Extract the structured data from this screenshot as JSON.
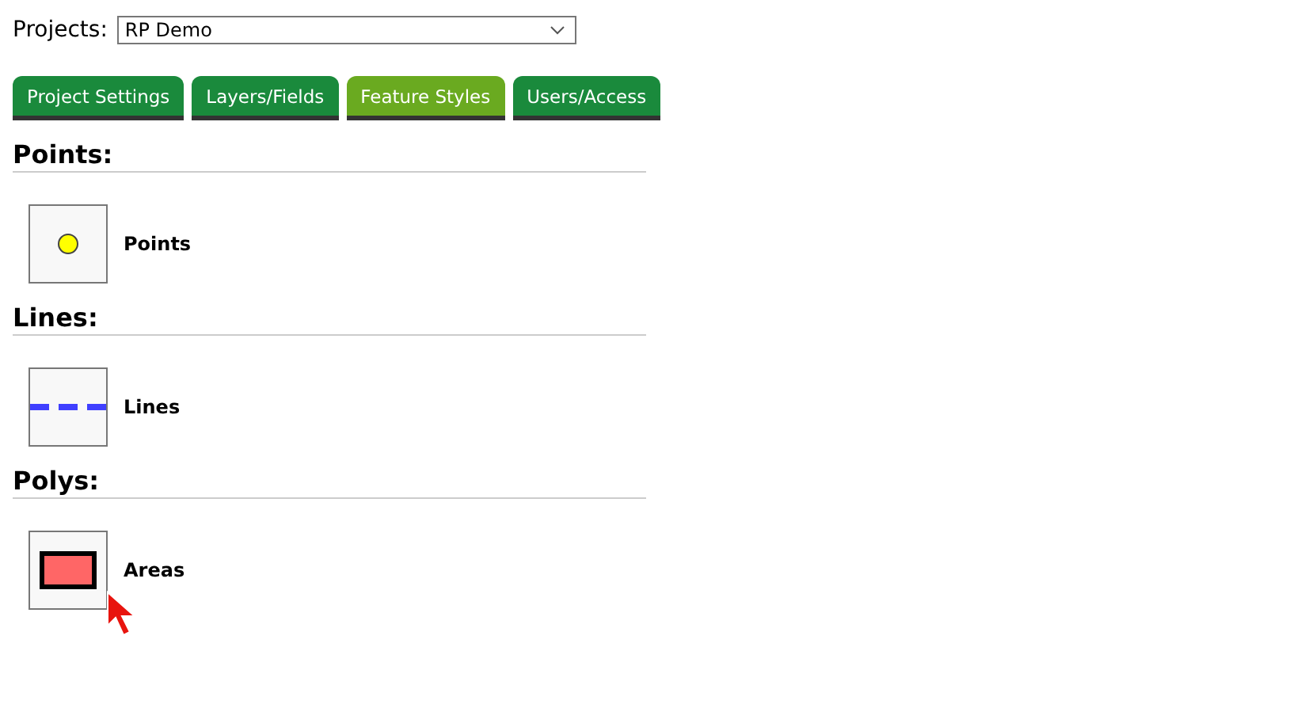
{
  "project_select": {
    "label": "Projects:",
    "value": "RP Demo"
  },
  "tabs": [
    {
      "label": "Project Settings",
      "selected": false
    },
    {
      "label": "Layers/Fields",
      "selected": false
    },
    {
      "label": "Feature Styles",
      "selected": true
    },
    {
      "label": "Users/Access",
      "selected": false
    }
  ],
  "sections": [
    {
      "heading": "Points:",
      "styles": [
        {
          "kind": "point",
          "label": "Points",
          "color": "#ffff00"
        }
      ]
    },
    {
      "heading": "Lines:",
      "styles": [
        {
          "kind": "line",
          "label": "Lines",
          "color": "#3f3fff"
        }
      ]
    },
    {
      "heading": "Polys:",
      "styles": [
        {
          "kind": "polygon",
          "label": "Areas",
          "color": "#ff6666"
        }
      ]
    }
  ]
}
